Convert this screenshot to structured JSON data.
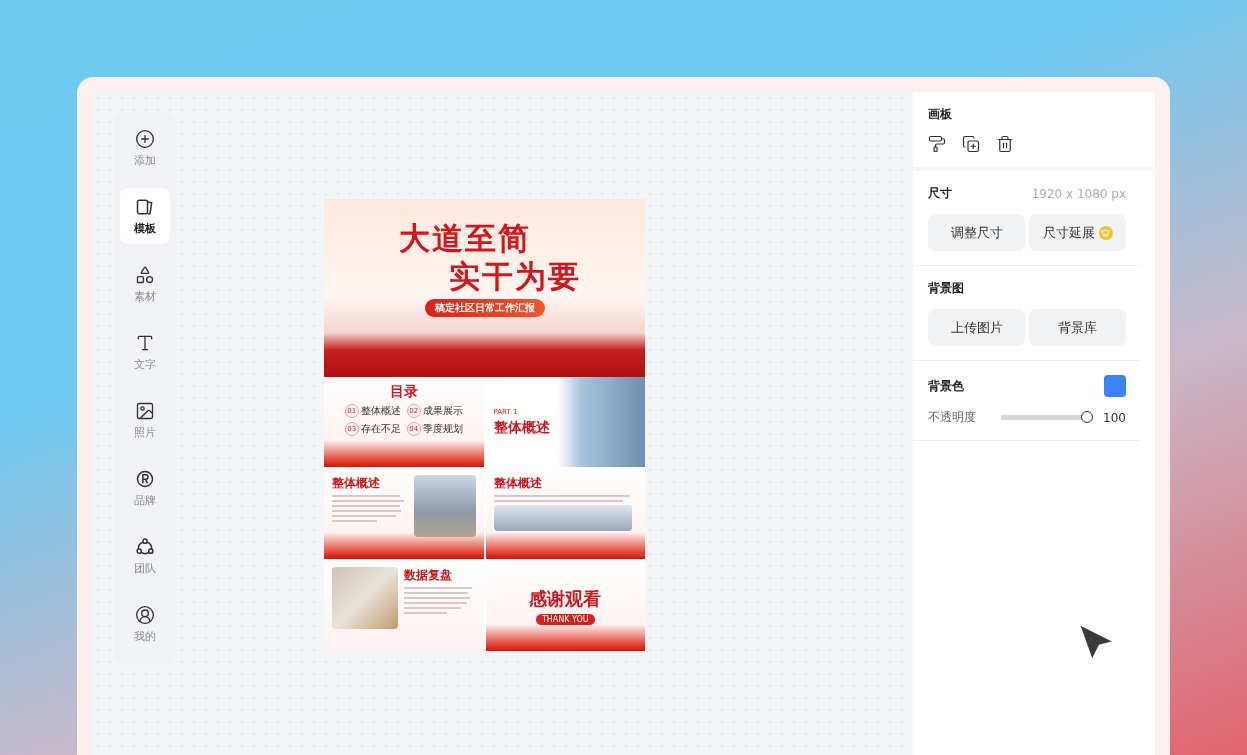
{
  "sidebar": {
    "items": [
      {
        "label": "添加",
        "selected": false
      },
      {
        "label": "模板",
        "selected": true
      },
      {
        "label": "素材",
        "selected": false
      },
      {
        "label": "文字",
        "selected": false
      },
      {
        "label": "照片",
        "selected": false
      },
      {
        "label": "品牌",
        "selected": false
      },
      {
        "label": "团队",
        "selected": false
      },
      {
        "label": "我的",
        "selected": false
      }
    ]
  },
  "canvas": {
    "slides": [
      {
        "kind": "cover",
        "title_lines": [
          "大道至简",
          "实干为要"
        ],
        "subtitle": "稿定社区日常工作汇报"
      },
      {
        "kind": "toc",
        "title": "目录",
        "items": [
          {
            "number": "01",
            "label": "整体概述"
          },
          {
            "number": "02",
            "label": "成果展示"
          },
          {
            "number": "03",
            "label": "存在不足"
          },
          {
            "number": "04",
            "label": "季度规划"
          }
        ]
      },
      {
        "kind": "section",
        "part": "PART 1",
        "title": "整体概述"
      },
      {
        "kind": "text_photo",
        "title": "整体概述"
      },
      {
        "kind": "columns",
        "title": "整体概述"
      },
      {
        "kind": "photo_text",
        "title": "数据复盘"
      },
      {
        "kind": "thanks",
        "title": "感谢观看",
        "subtitle": "THANK YOU"
      }
    ]
  },
  "panel": {
    "artboard": {
      "title": "画板"
    },
    "size": {
      "title": "尺寸",
      "value": "1920 x 1080 px",
      "buttons": [
        {
          "label": "调整尺寸",
          "premium": false
        },
        {
          "label": "尺寸延展",
          "premium": true
        }
      ]
    },
    "background_image": {
      "title": "背景图",
      "buttons": [
        {
          "label": "上传图片",
          "premium": false
        },
        {
          "label": "背景库",
          "premium": false
        }
      ]
    },
    "background_color": {
      "title": "背景色",
      "color": "#3b82f6",
      "opacity_label": "不透明度",
      "level": 1,
      "reading": "100"
    }
  }
}
